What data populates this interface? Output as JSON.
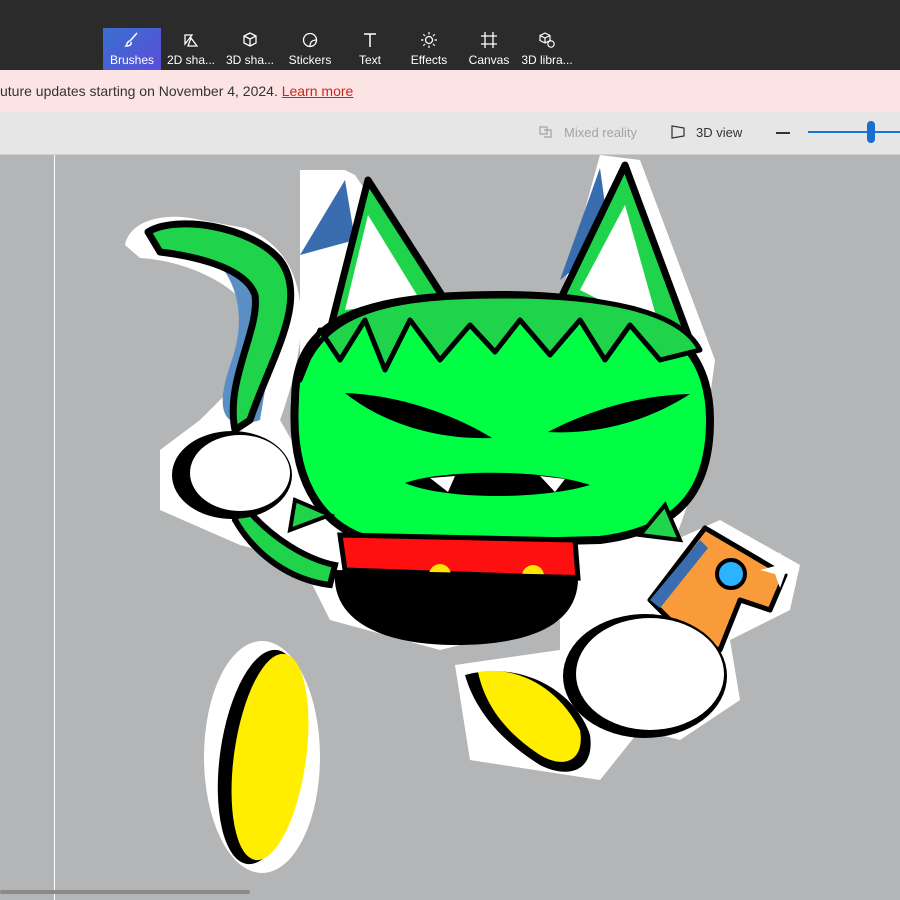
{
  "toolbar": {
    "tools": [
      {
        "label": "Brushes",
        "icon": "brush-icon",
        "active": true
      },
      {
        "label": "2D sha...",
        "icon": "2d-shapes-icon"
      },
      {
        "label": "3D sha...",
        "icon": "3d-shapes-icon"
      },
      {
        "label": "Stickers",
        "icon": "stickers-icon"
      },
      {
        "label": "Text",
        "icon": "text-icon"
      },
      {
        "label": "Effects",
        "icon": "effects-icon"
      },
      {
        "label": "Canvas",
        "icon": "canvas-icon"
      },
      {
        "label": "3D libra...",
        "icon": "3d-library-icon"
      }
    ],
    "accent_color": "#3a6fd0"
  },
  "banner": {
    "message": "uture updates starting on November 4, 2024.",
    "link": "Learn more",
    "link_color": "#c42b1c",
    "background": "#fce4e4"
  },
  "viewbar": {
    "mixed_reality": "Mixed reality",
    "view_3d": "3D view",
    "zoom_level": 0.65
  },
  "canvas": {
    "background": "#b4b5b6",
    "drawing": "green cat character with red collar, yellow feet and orange wand"
  }
}
